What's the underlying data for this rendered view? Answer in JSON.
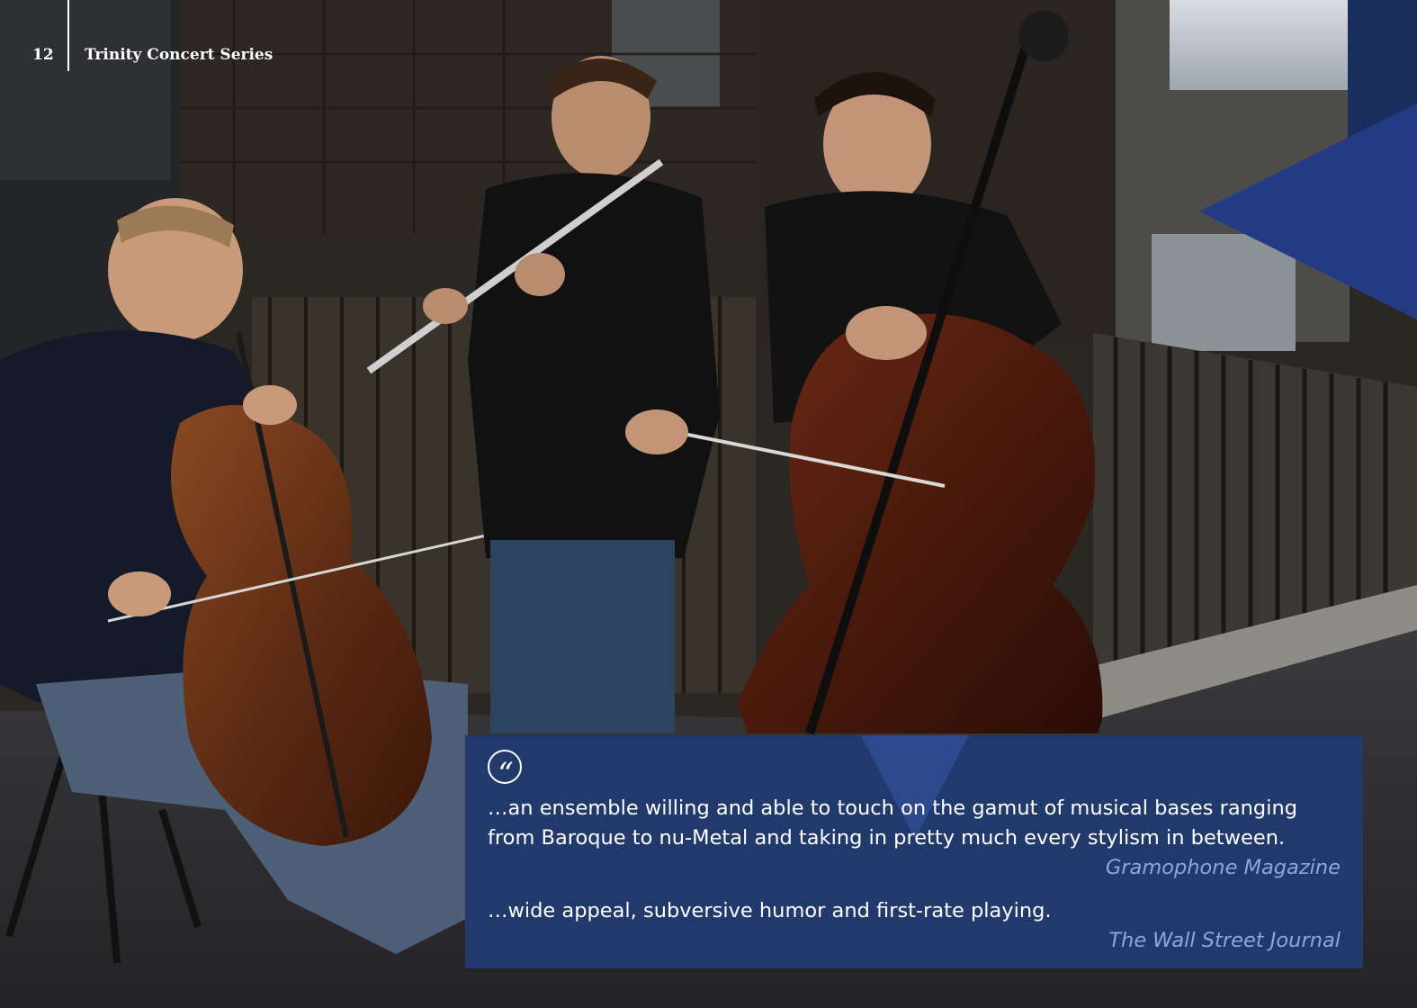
{
  "header": {
    "page_number": "12",
    "series_title": "Trinity Concert Series"
  },
  "quotes": [
    {
      "text": "…an ensemble willing and able to touch on the gamut of musical bases ranging from Baroque to nu-Metal and taking in pretty much every stylism in between.",
      "source": "Gramophone Magazine"
    },
    {
      "text": "…wide appeal, subversive humor and first-rate playing.",
      "source": "The Wall Street Journal"
    }
  ],
  "quote_mark_glyph": "“",
  "colors": {
    "quote_box": "#213a6b",
    "accent_blue": "#233a85",
    "source_text": "#8fa6dc",
    "dark_navy": "#1a2e5e"
  },
  "icons": {
    "quote_mark": "quote-mark-icon"
  }
}
